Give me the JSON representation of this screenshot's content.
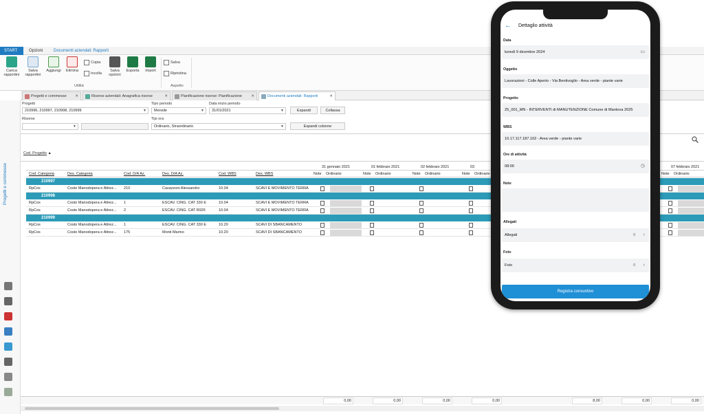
{
  "ribbon": {
    "tabs": [
      "START",
      "Opzioni",
      "Documenti aziendali: Rapporti"
    ],
    "buttons": {
      "carica": "Carica rapportini",
      "salva_rapportini": "Salva rapportini",
      "aggiungi": "Aggiungi",
      "elimina": "Elimina",
      "copia": "Copia",
      "incolla": "Incolla",
      "salva_opzioni": "Salva opzioni",
      "esporta": "Esporta",
      "import": "Import",
      "salva": "Salva",
      "ripristina": "Ripristina"
    },
    "groups": {
      "utilita": "Utilità",
      "aspetto": "Aspetto"
    }
  },
  "doc_tabs": [
    {
      "label": "Progetti e commesse"
    },
    {
      "label": "Risorse aziendali: Anagrafica risorse"
    },
    {
      "label": "Pianificazione risorse: Pianificazione"
    },
    {
      "label": "Documenti aziendali: Rapporti"
    }
  ],
  "sidebar": {
    "label": "Progetti e commesse"
  },
  "filters": {
    "progetti_label": "Progetti",
    "progetti_value": "210996, 210997, 210998, 210999",
    "tipo_periodo_label": "Tipo periodo",
    "tipo_periodo_value": "Mensile",
    "data_inizio_label": "Data inizio periodo",
    "data_inizio_value": "31/01/2021",
    "risorse_label": "Risorse",
    "tipi_ora_label": "Tipi ora",
    "tipi_ora_value": "Ordinario, Straordinario",
    "espandi": "Espandi",
    "collassa": "Collassa",
    "espandi_colonne": "Espandi colonne"
  },
  "grid": {
    "group_by": "Cod. Progetto",
    "columns": [
      "Cod. Categoria",
      "Des. Categoria",
      "Cod. D/A Az.",
      "Des. D/A Az.",
      "Cod. WBS",
      "Des. WBS"
    ],
    "date_headers": [
      "31 gennaio 2021",
      "01 febbraio 2021",
      "02 febbraio 2021",
      "03",
      "07 febbraio 2021"
    ],
    "sub_headers": [
      "Note",
      "Ordinario"
    ],
    "groups": [
      {
        "code": "210997",
        "rows": [
          [
            "RpCos",
            "Costo Manodopera e Attrez...",
            "210",
            "Cavazzoni Alessandro",
            "10.04",
            "SCAVI E MOVIMENTO TERRA"
          ]
        ]
      },
      {
        "code": "210998",
        "rows": [
          [
            "RpCos",
            "Costo Manodopera e Attrez...",
            "1",
            "ESCAV. CING. CAT 330 E",
            "10.04",
            "SCAVI E MOVIMENTO TERRA"
          ],
          [
            "RpCos",
            "Costo Manodopera e Attrez...",
            "2",
            "ESCAV. CING. CAT R926",
            "10.04",
            "SCAVI E MOVIMENTO TERRA"
          ]
        ]
      },
      {
        "code": "210999",
        "rows": [
          [
            "RpCos",
            "Costo Manodopera e Attrez...",
            "1",
            "ESCAV. CING. CAT 330 E",
            "10.20",
            "SCAVI DI SBANCAMENTO"
          ],
          [
            "RpCos",
            "Costo Manodopera e Attrez...",
            "175",
            "Monti Marino",
            "10.20",
            "SCAVI DI SBANCAMENTO"
          ]
        ]
      }
    ],
    "footer_totals": [
      "0,00",
      "0,00",
      "0,00",
      "0,00",
      "8,00",
      "0,00",
      "0,00"
    ]
  },
  "phone": {
    "title": "Dettaglio attività",
    "data_label": "Data",
    "data_value": "lunedì 9 dicembre 2024",
    "oggetto_label": "Oggetto",
    "oggetto_value": "Lavorazioni - Colle Aperto - Via Bentivoglio - Area verde - piante varie",
    "progetto_label": "Progetto",
    "progetto_value": "25_001_MN - INTERVENTI di MANUTENZIONE Comune di Mantova 2025",
    "wbs_label": "WBS",
    "wbs_value": "10.17.117.187.102 - Area verde - piante varie",
    "ore_label": "Ore di attività",
    "ore_value": "08:00",
    "note_label": "Note",
    "allegati_label": "Allegati",
    "allegati_value": "Allegati",
    "allegati_count": "0",
    "foto_label": "Foto",
    "foto_value": "Foto",
    "foto_count": "0",
    "button": "Registra consuntivo"
  }
}
